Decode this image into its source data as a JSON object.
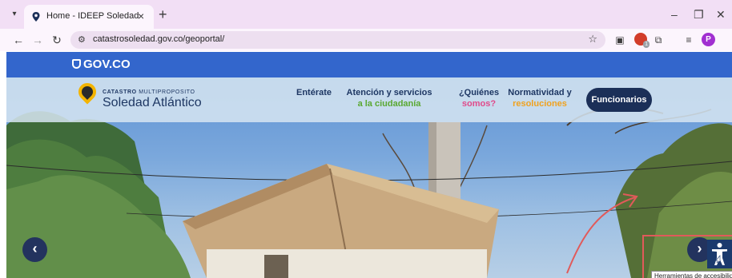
{
  "browser": {
    "tab_title": "Home - IDEEP Soledad",
    "url": "catastrosoledad.gov.co/geoportal/",
    "profile_initial": "P",
    "extension_badge": "1"
  },
  "gov_bar": {
    "logo": "GOV.CO",
    "color": "#3366cc"
  },
  "site": {
    "brand_bold": "CATASTRO",
    "brand_rest": "MULTIPROPOSITO",
    "brand_name": "Soledad Atlántico",
    "nav": [
      {
        "line1": "Entérate",
        "line2": "",
        "line2_color": ""
      },
      {
        "line1": "Atención y servicios",
        "line2": "a la ciudadanía",
        "line2_color": "#5aa832"
      },
      {
        "line1": "¿Quiénes",
        "line2": "somos?",
        "line2_color": "#e04a8a"
      },
      {
        "line1": "Normatividad y",
        "line2": "resoluciones",
        "line2_color": "#f0a21f"
      }
    ],
    "cta": "Funcionarios",
    "tooltip": "Herramientas de accesibilidad"
  },
  "icons": {
    "tab_search": "chevron-down-icon",
    "favicon": "location-pin-icon",
    "back": "arrow-left-icon",
    "forward": "arrow-right-icon",
    "reload": "reload-icon",
    "site_info": "tune-icon",
    "bookmark": "star-icon",
    "accessibility": "accessibility-icon"
  },
  "colors": {
    "tab_strip": "#f2dff5",
    "nav_dark": "#1e3763",
    "cta_bg": "#1b2f58",
    "annotation": "#e15a5a"
  }
}
